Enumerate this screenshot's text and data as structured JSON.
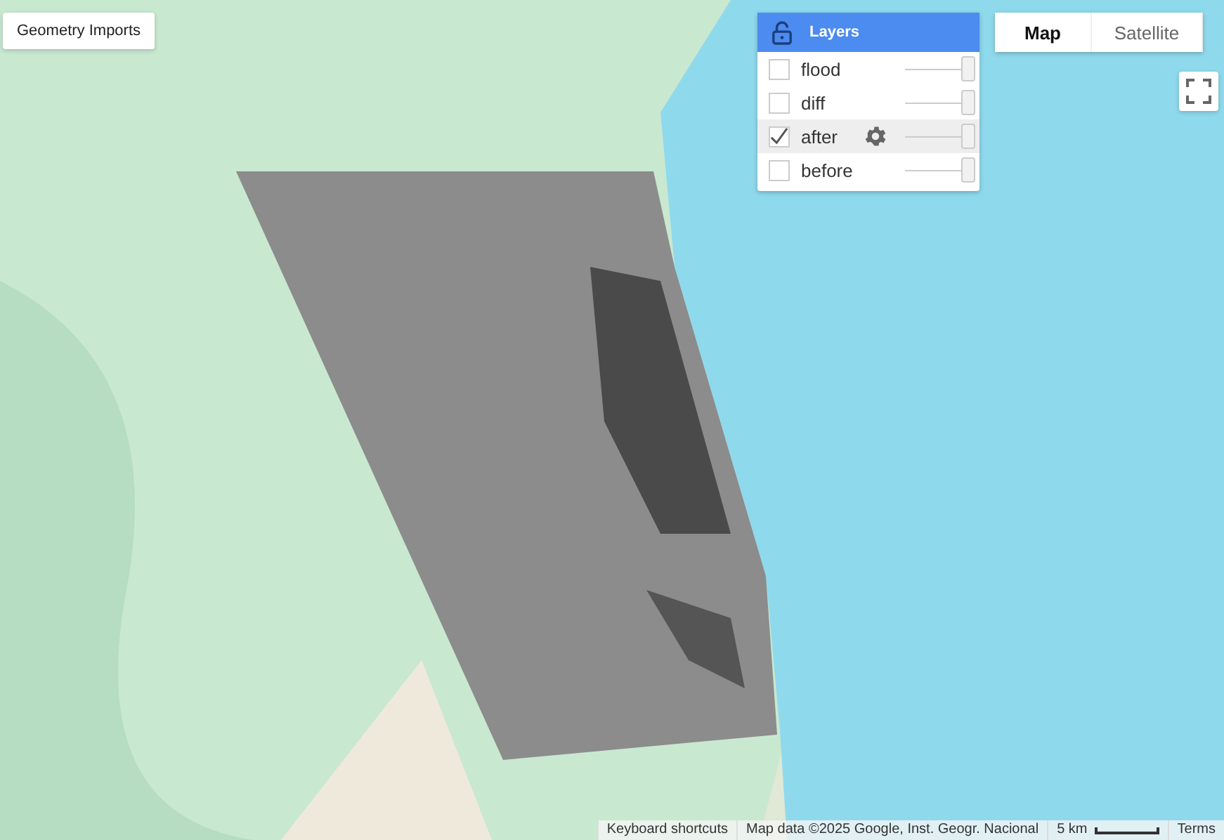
{
  "geometry_imports": {
    "label": "Geometry Imports"
  },
  "layers_panel": {
    "title": "Layers",
    "layers": [
      {
        "name": "flood",
        "checked": false,
        "selected": false,
        "level": 1
      },
      {
        "name": "diff",
        "checked": false,
        "selected": false,
        "level": 1
      },
      {
        "name": "after",
        "checked": true,
        "selected": true,
        "level": 1
      },
      {
        "name": "before",
        "checked": false,
        "selected": false,
        "level": 1
      }
    ]
  },
  "map_type_tabs": [
    {
      "label": "Map",
      "selected": true
    },
    {
      "label": "Satellite",
      "selected": false
    }
  ],
  "attribution": {
    "shortcuts": "Keyboard shortcuts",
    "map_data": "Map data ©2025 Google, Inst. Geogr. Nacional",
    "scale": "5 km",
    "terms": "Terms"
  }
}
